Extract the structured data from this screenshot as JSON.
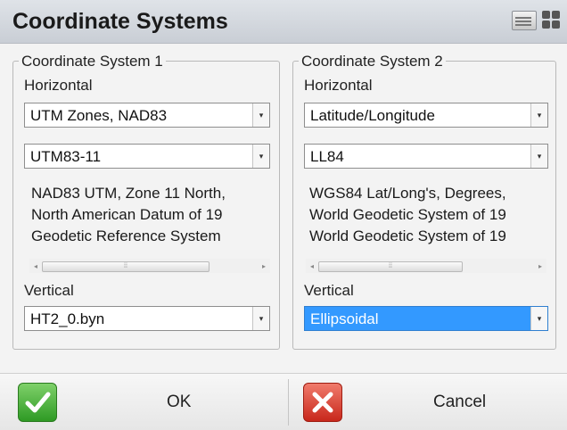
{
  "window": {
    "title": "Coordinate Systems",
    "icons": [
      "keyboard-icon",
      "grid-icon"
    ]
  },
  "cs1": {
    "legend": "Coordinate System 1",
    "horizontal_label": "Horizontal",
    "zone_group": "UTM Zones, NAD83",
    "zone": "UTM83-11",
    "description": [
      "NAD83 UTM, Zone 11 North,",
      "North American Datum of 19",
      "Geodetic Reference System"
    ],
    "vertical_label": "Vertical",
    "vertical": "HT2_0.byn"
  },
  "cs2": {
    "legend": "Coordinate System 2",
    "horizontal_label": "Horizontal",
    "zone_group": "Latitude/Longitude",
    "zone": "LL84",
    "description": [
      "WGS84 Lat/Long's, Degrees,",
      "World Geodetic System of 19",
      "World Geodetic System of 19"
    ],
    "vertical_label": "Vertical",
    "vertical": "Ellipsoidal"
  },
  "buttons": {
    "ok": "OK",
    "cancel": "Cancel"
  },
  "colors": {
    "selection": "#3399ff",
    "ok_green": "#2e9a24",
    "cancel_red": "#c8271b"
  }
}
